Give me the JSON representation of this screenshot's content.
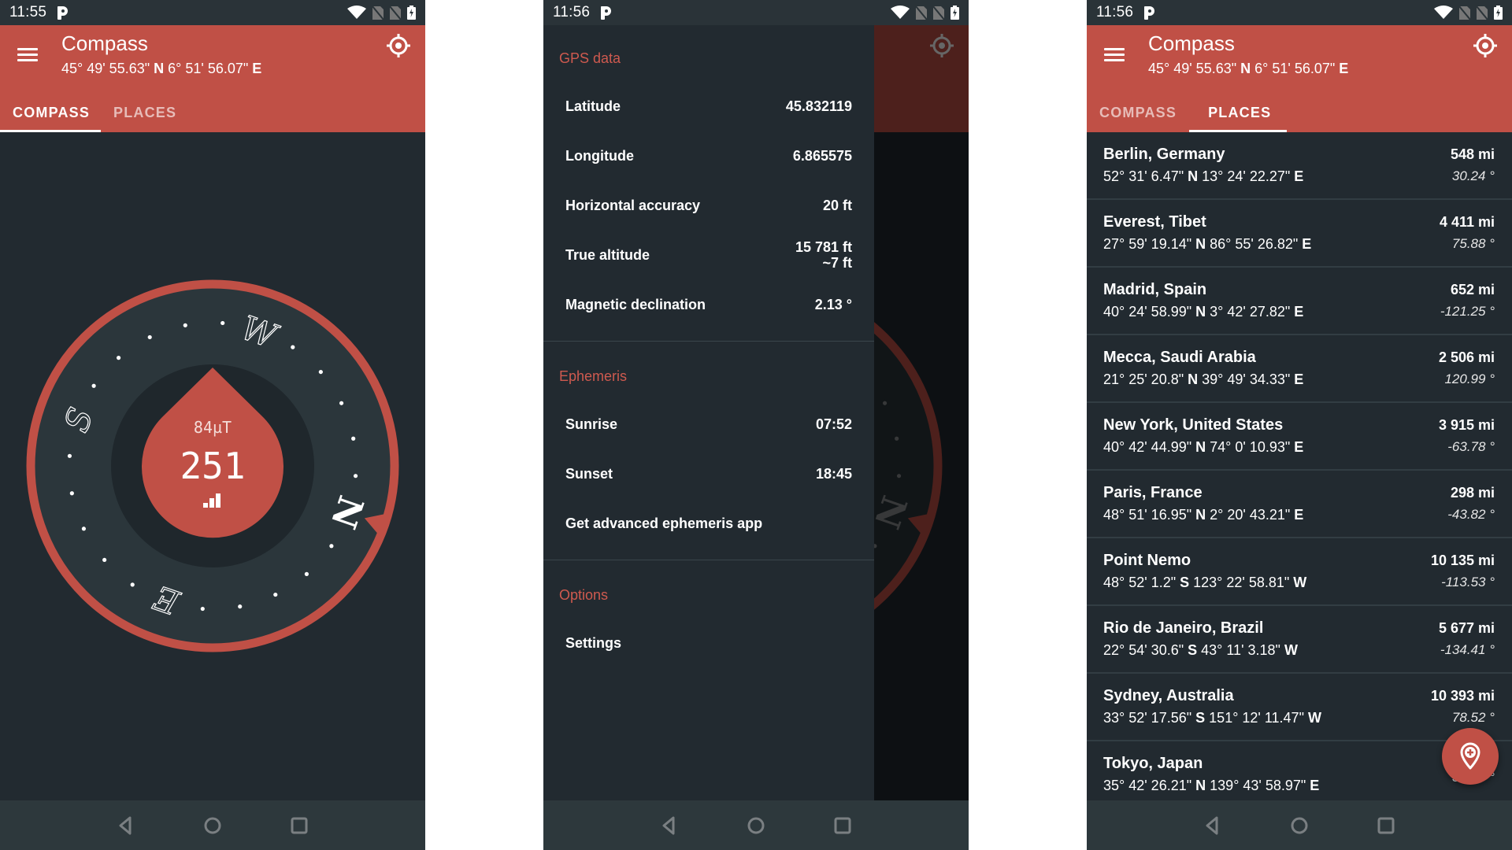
{
  "colors": {
    "accent": "#c05046",
    "background": "#222a30",
    "dial": "#2b363b",
    "inner_disk": "#1f272c",
    "section_title": "#cf5a4f"
  },
  "phones": [
    {
      "status_bar": {
        "time": "11:55",
        "icons": [
          "parking-app-icon",
          "wifi-icon",
          "no-sim-icon",
          "no-sim-icon",
          "battery-charging-icon"
        ]
      },
      "app_bar": {
        "title": "Compass",
        "subtitle_lat": "45° 49' 55.63\"",
        "subtitle_lat_dir": "N",
        "subtitle_lon": "6° 51' 56.07\"",
        "subtitle_lon_dir": "E",
        "menu_icon": "hamburger-menu-icon",
        "locate_icon": "gps-locate-icon"
      },
      "tabs": [
        {
          "label": "COMPASS",
          "active": true
        },
        {
          "label": "PLACES",
          "active": false
        }
      ],
      "compass": {
        "heading": 251,
        "field_strength": "84µT",
        "heading_label": "251",
        "signal_bars": 3,
        "cardinals": [
          "N",
          "E",
          "S",
          "W"
        ]
      },
      "nav_bar": [
        "back-icon",
        "home-icon",
        "recents-icon"
      ]
    },
    {
      "status_bar": {
        "time": "11:56"
      },
      "drawer": {
        "sections": [
          {
            "title": "GPS data",
            "rows": [
              {
                "label": "Latitude",
                "value": "45.832119"
              },
              {
                "label": "Longitude",
                "value": "6.865575"
              },
              {
                "label": "Horizontal accuracy",
                "value": "20 ft"
              },
              {
                "label": "True altitude",
                "value": "15 781 ft",
                "value2": "~7 ft"
              },
              {
                "label": "Magnetic declination",
                "value": "2.13 °"
              }
            ]
          },
          {
            "title": "Ephemeris",
            "rows": [
              {
                "label": "Sunrise",
                "value": "07:52"
              },
              {
                "label": "Sunset",
                "value": "18:45"
              },
              {
                "label": "Get advanced ephemeris app",
                "value": ""
              }
            ]
          },
          {
            "title": "Options",
            "rows": [
              {
                "label": "Settings",
                "value": ""
              }
            ]
          }
        ]
      }
    },
    {
      "status_bar": {
        "time": "11:56"
      },
      "app_bar": {
        "title": "Compass",
        "subtitle_lat": "45° 49' 55.63\"",
        "subtitle_lat_dir": "N",
        "subtitle_lon": "6° 51' 56.07\"",
        "subtitle_lon_dir": "E"
      },
      "tabs": [
        {
          "label": "COMPASS",
          "active": false
        },
        {
          "label": "PLACES",
          "active": true
        }
      ],
      "places": [
        {
          "name": "Berlin, Germany",
          "lat": "52° 31' 6.47\"",
          "lat_dir": "N",
          "lon": "13° 24' 22.27\"",
          "lon_dir": "E",
          "distance": "548 mi",
          "bearing": "30.24 °"
        },
        {
          "name": "Everest, Tibet",
          "lat": "27° 59' 19.14\"",
          "lat_dir": "N",
          "lon": "86° 55' 26.82\"",
          "lon_dir": "E",
          "distance": "4 411 mi",
          "bearing": "75.88 °"
        },
        {
          "name": "Madrid, Spain",
          "lat": "40° 24' 58.99\"",
          "lat_dir": "N",
          "lon": "3° 42' 27.82\"",
          "lon_dir": "E",
          "distance": "652 mi",
          "bearing": "-121.25 °"
        },
        {
          "name": "Mecca, Saudi Arabia",
          "lat": "21° 25' 20.8\"",
          "lat_dir": "N",
          "lon": "39° 49' 34.33\"",
          "lon_dir": "E",
          "distance": "2 506 mi",
          "bearing": "120.99 °"
        },
        {
          "name": "New York, United States",
          "lat": "40° 42' 44.99\"",
          "lat_dir": "N",
          "lon": "74° 0' 10.93\"",
          "lon_dir": "E",
          "distance": "3 915 mi",
          "bearing": "-63.78 °"
        },
        {
          "name": "Paris, France",
          "lat": "48° 51' 16.95\"",
          "lat_dir": "N",
          "lon": "2° 20' 43.21\"",
          "lon_dir": "E",
          "distance": "298 mi",
          "bearing": "-43.82 °"
        },
        {
          "name": "Point Nemo",
          "lat": "48° 52' 1.2\"",
          "lat_dir": "S",
          "lon": "123° 22' 58.81\"",
          "lon_dir": "W",
          "distance": "10 135 mi",
          "bearing": "-113.53 °"
        },
        {
          "name": "Rio de Janeiro, Brazil",
          "lat": "22° 54' 30.6\"",
          "lat_dir": "S",
          "lon": "43° 11' 3.18\"",
          "lon_dir": "W",
          "distance": "5 677 mi",
          "bearing": "-134.41 °"
        },
        {
          "name": "Sydney, Australia",
          "lat": "33° 52' 17.56\"",
          "lat_dir": "S",
          "lon": "151° 12' 11.47\"",
          "lon_dir": "W",
          "distance": "10 393 mi",
          "bearing": "78.52 °"
        },
        {
          "name": "Tokyo, Japan",
          "lat": "35° 42' 26.21\"",
          "lat_dir": "N",
          "lon": "139° 43' 58.97\"",
          "lon_dir": "E",
          "distance": "",
          "bearing": "36.07 °"
        }
      ],
      "fab": {
        "icon": "add-location-icon"
      }
    }
  ]
}
